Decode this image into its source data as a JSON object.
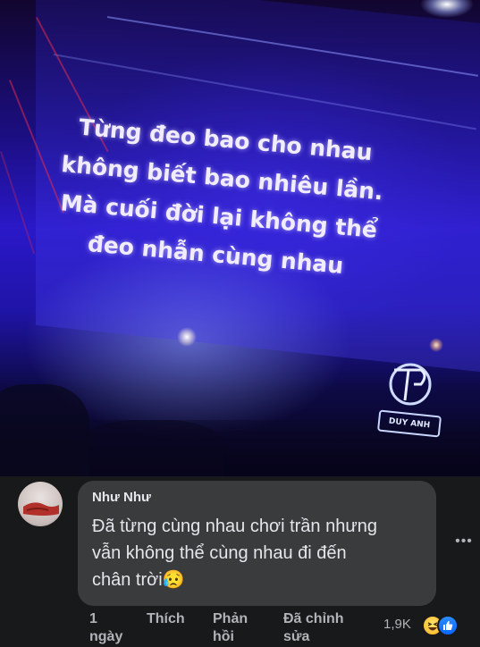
{
  "photo": {
    "lyrics": [
      "Từng đeo bao cho nhau",
      "không biết bao nhiêu lần.",
      "Mà cuối đời lại không thể",
      "đeo nhẫn cùng nhau"
    ],
    "logo_text": "DUY ANH"
  },
  "comment": {
    "author": "Như Như",
    "text_lines": [
      "Đã từng cùng nhau chơi trần nhưng",
      "vẫn không thể cùng nhau đi đến",
      "chân trời😥"
    ],
    "more_icon": "more-horizontal-icon",
    "actions": {
      "time_line1": "1",
      "time_line2": "ngày",
      "like": "Thích",
      "reply_line1": "Phản",
      "reply_line2": "hồi",
      "edited_line1": "Đã chỉnh",
      "edited_line2": "sửa"
    },
    "reactions": {
      "count": "1,9K",
      "icons": [
        "haha-emoji-icon",
        "like-emoji-icon"
      ]
    }
  },
  "colors": {
    "background": "#18191a",
    "bubble": "#3a3b3c",
    "text_primary": "#e4e6eb",
    "text_secondary": "#b0b3b8",
    "stage_blue": "#2a18c8",
    "like_blue": "#0866ff",
    "haha_yellow": "#f7b125"
  }
}
